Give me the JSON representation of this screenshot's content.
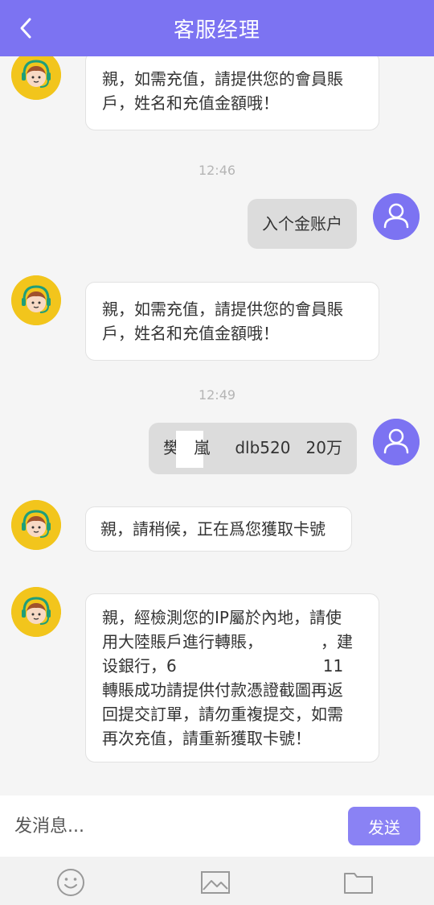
{
  "header": {
    "title": "客服经理",
    "back_icon": "chevron-left-icon",
    "color": "#7c73f2"
  },
  "messages": [
    {
      "type": "agent",
      "lines": [
        "親，如需充值，請提供您的會員賬",
        "戶，姓名和充值金額哦！"
      ]
    },
    {
      "type": "time",
      "text": "12:46"
    },
    {
      "type": "user",
      "text": "入个金账户"
    },
    {
      "type": "agent",
      "lines": [
        "親，如需充值，請提供您的會員賬",
        "戶，姓名和充值金額哦！"
      ]
    },
    {
      "type": "time",
      "text": "12:49"
    },
    {
      "type": "user",
      "name_prefix": "樊",
      "name_suffix": "嵐",
      "account": "dlb520",
      "amount": "20万"
    },
    {
      "type": "agent",
      "lines": [
        "親，請稍候，正在爲您獲取卡號"
      ]
    },
    {
      "type": "agent",
      "lines": [
        "親，經檢測您的IP屬於內地，請使",
        "用大陸賬戶進行轉賬，",
        "，建",
        "设銀行，6",
        "11",
        "轉賬成功請提供付款憑證截圖再返",
        "回提交訂單，請勿重複提交，如需",
        "再次充值，請重新獲取卡號！"
      ]
    }
  ],
  "composer": {
    "placeholder": "发消息...",
    "send_label": "发送"
  },
  "toolbar": {
    "icons": [
      "emoji-icon",
      "image-icon",
      "folder-icon"
    ]
  },
  "colors": {
    "accent": "#7c73f2",
    "agent_avatar_bg": "#f2c51c",
    "user_bubble": "#dcdcdc",
    "agent_bubble": "#ffffff"
  }
}
